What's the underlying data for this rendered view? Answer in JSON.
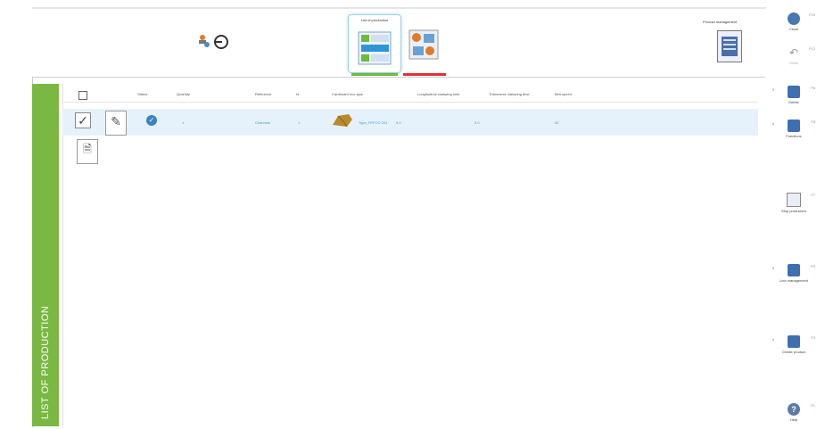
{
  "sidebar": {
    "title": "LIST OF PRODUCTION"
  },
  "toolbar": {
    "production_tab_label": "List of production",
    "product_management_label": "Product management"
  },
  "table": {
    "headers": [
      "Status",
      "Quantity",
      "Reference",
      "Id",
      "Cardboard box type",
      "Longitudinal clamping time",
      "Transverse clamping time",
      "Belt speed"
    ],
    "row": {
      "quantity": "1",
      "reference": "Channels",
      "id": "1",
      "box_type": "Type_FEFCO 201",
      "longitudinal": "5.0",
      "transverse": "5.0",
      "belt_speed": "30"
    },
    "edit_label": "Edit",
    "new_label": "New"
  },
  "right_panel": {
    "buttons": [
      {
        "label": "Close",
        "key": "F10"
      },
      {
        "label": "Undo",
        "key": "F12"
      },
      {
        "label": "Delete",
        "key": "F6",
        "num": "5"
      },
      {
        "label": "Functions",
        "key": "F8",
        "num": "6"
      },
      {
        "label": "Stop production",
        "key": "F7"
      },
      {
        "label": "Line management",
        "key": "F9",
        "num": "8"
      },
      {
        "label": "Create product",
        "key": "F3",
        "num": "9"
      },
      {
        "label": "Help",
        "key": "F1"
      }
    ]
  },
  "colors": {
    "sidebar": "#7ab843",
    "accent_blue": "#3a9bd8",
    "row_highlight": "#e6f2fb",
    "tab_green": "#6dbb3a",
    "tab_red": "#e0303a"
  }
}
